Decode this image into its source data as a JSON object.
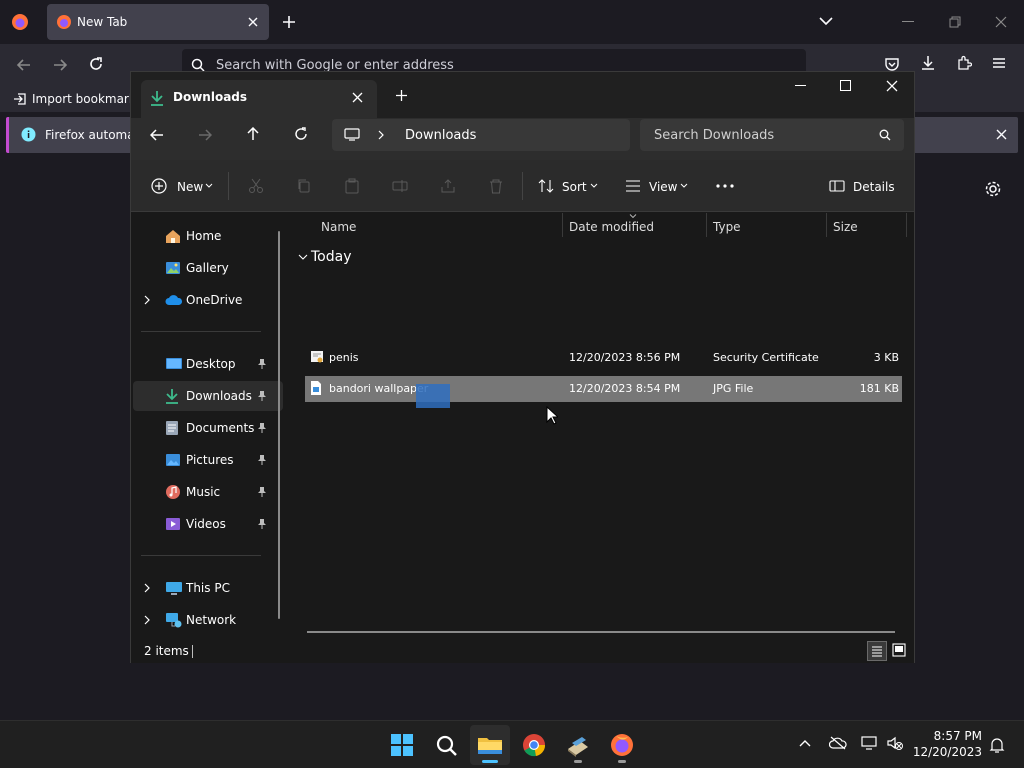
{
  "browser": {
    "tab_title": "New Tab",
    "url_placeholder": "Search with Google or enter address",
    "bookmark_import": "Import bookmarks",
    "notice_text": "Firefox automati"
  },
  "explorer": {
    "tab_title": "Downloads",
    "address": {
      "breadcrumb": "Downloads"
    },
    "search_placeholder": "Search Downloads",
    "toolbar": {
      "new_label": "New",
      "sort_label": "Sort",
      "view_label": "View",
      "details_label": "Details"
    },
    "nav": {
      "home": "Home",
      "gallery": "Gallery",
      "onedrive": "OneDrive",
      "desktop": "Desktop",
      "downloads": "Downloads",
      "documents": "Documents",
      "pictures": "Pictures",
      "music": "Music",
      "videos": "Videos",
      "thispc": "This PC",
      "network": "Network"
    },
    "columns": {
      "name": "Name",
      "date": "Date modified",
      "type": "Type",
      "size": "Size"
    },
    "group": "Today",
    "files": [
      {
        "name": "penis",
        "date": "12/20/2023 8:56 PM",
        "type": "Security Certificate",
        "size": "3 KB"
      },
      {
        "name": "bandori wallpaper",
        "date": "12/20/2023 8:54 PM",
        "type": "JPG File",
        "size": "181 KB"
      }
    ],
    "status": {
      "items": "2 items"
    }
  },
  "taskbar": {
    "time": "8:57 PM",
    "date": "12/20/2023"
  },
  "colors": {
    "accent": "#4cc2ff",
    "selection": "#777777",
    "firefox_notice": "#c34bd0"
  }
}
